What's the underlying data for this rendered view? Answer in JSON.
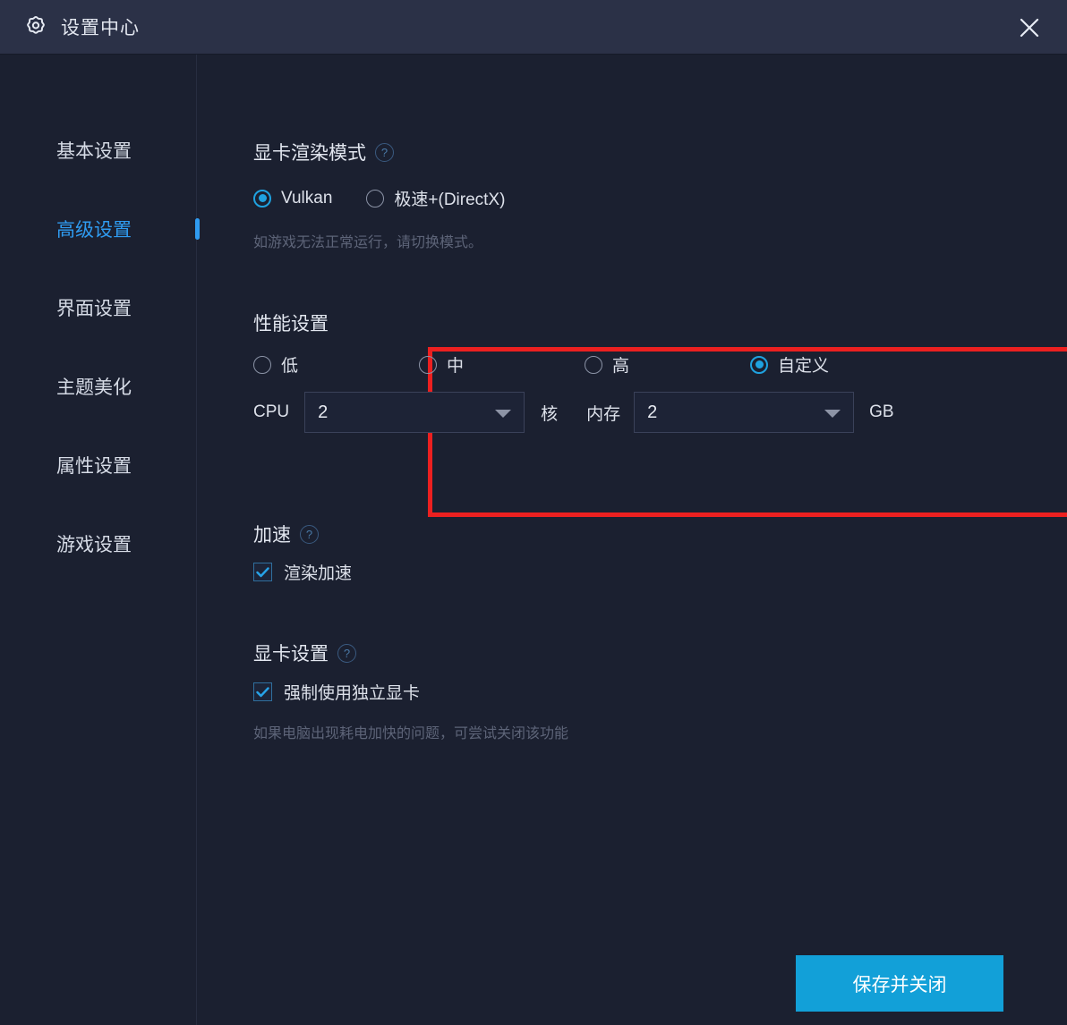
{
  "window": {
    "title": "设置中心",
    "gear_icon": "gear-icon",
    "close_icon": "close-icon"
  },
  "sidebar": {
    "items": [
      {
        "label": "基本设置",
        "active": false
      },
      {
        "label": "高级设置",
        "active": true
      },
      {
        "label": "界面设置",
        "active": false
      },
      {
        "label": "主题美化",
        "active": false
      },
      {
        "label": "属性设置",
        "active": false
      },
      {
        "label": "游戏设置",
        "active": false
      }
    ]
  },
  "render_mode": {
    "title": "显卡渲染模式",
    "help": "?",
    "options": [
      {
        "label": "Vulkan",
        "selected": true
      },
      {
        "label": "极速+(DirectX)",
        "selected": false
      }
    ],
    "hint": "如游戏无法正常运行，请切换模式。"
  },
  "performance": {
    "title": "性能设置",
    "highlight_color": "#ec2020",
    "options": [
      {
        "label": "低",
        "selected": false
      },
      {
        "label": "中",
        "selected": false
      },
      {
        "label": "高",
        "selected": false
      },
      {
        "label": "自定义",
        "selected": true
      }
    ],
    "cpu": {
      "label": "CPU",
      "value": "2",
      "unit": "核"
    },
    "memory": {
      "label": "内存",
      "value": "2",
      "unit": "GB"
    }
  },
  "acceleration": {
    "title": "加速",
    "help": "?",
    "checkbox": {
      "label": "渲染加速",
      "checked": true
    }
  },
  "graphics": {
    "title": "显卡设置",
    "help": "?",
    "checkbox": {
      "label": "强制使用独立显卡",
      "checked": true
    },
    "hint": "如果电脑出现耗电加快的问题，可尝试关闭该功能"
  },
  "footer": {
    "save_label": "保存并关闭",
    "accent_color": "#12a0d8"
  }
}
